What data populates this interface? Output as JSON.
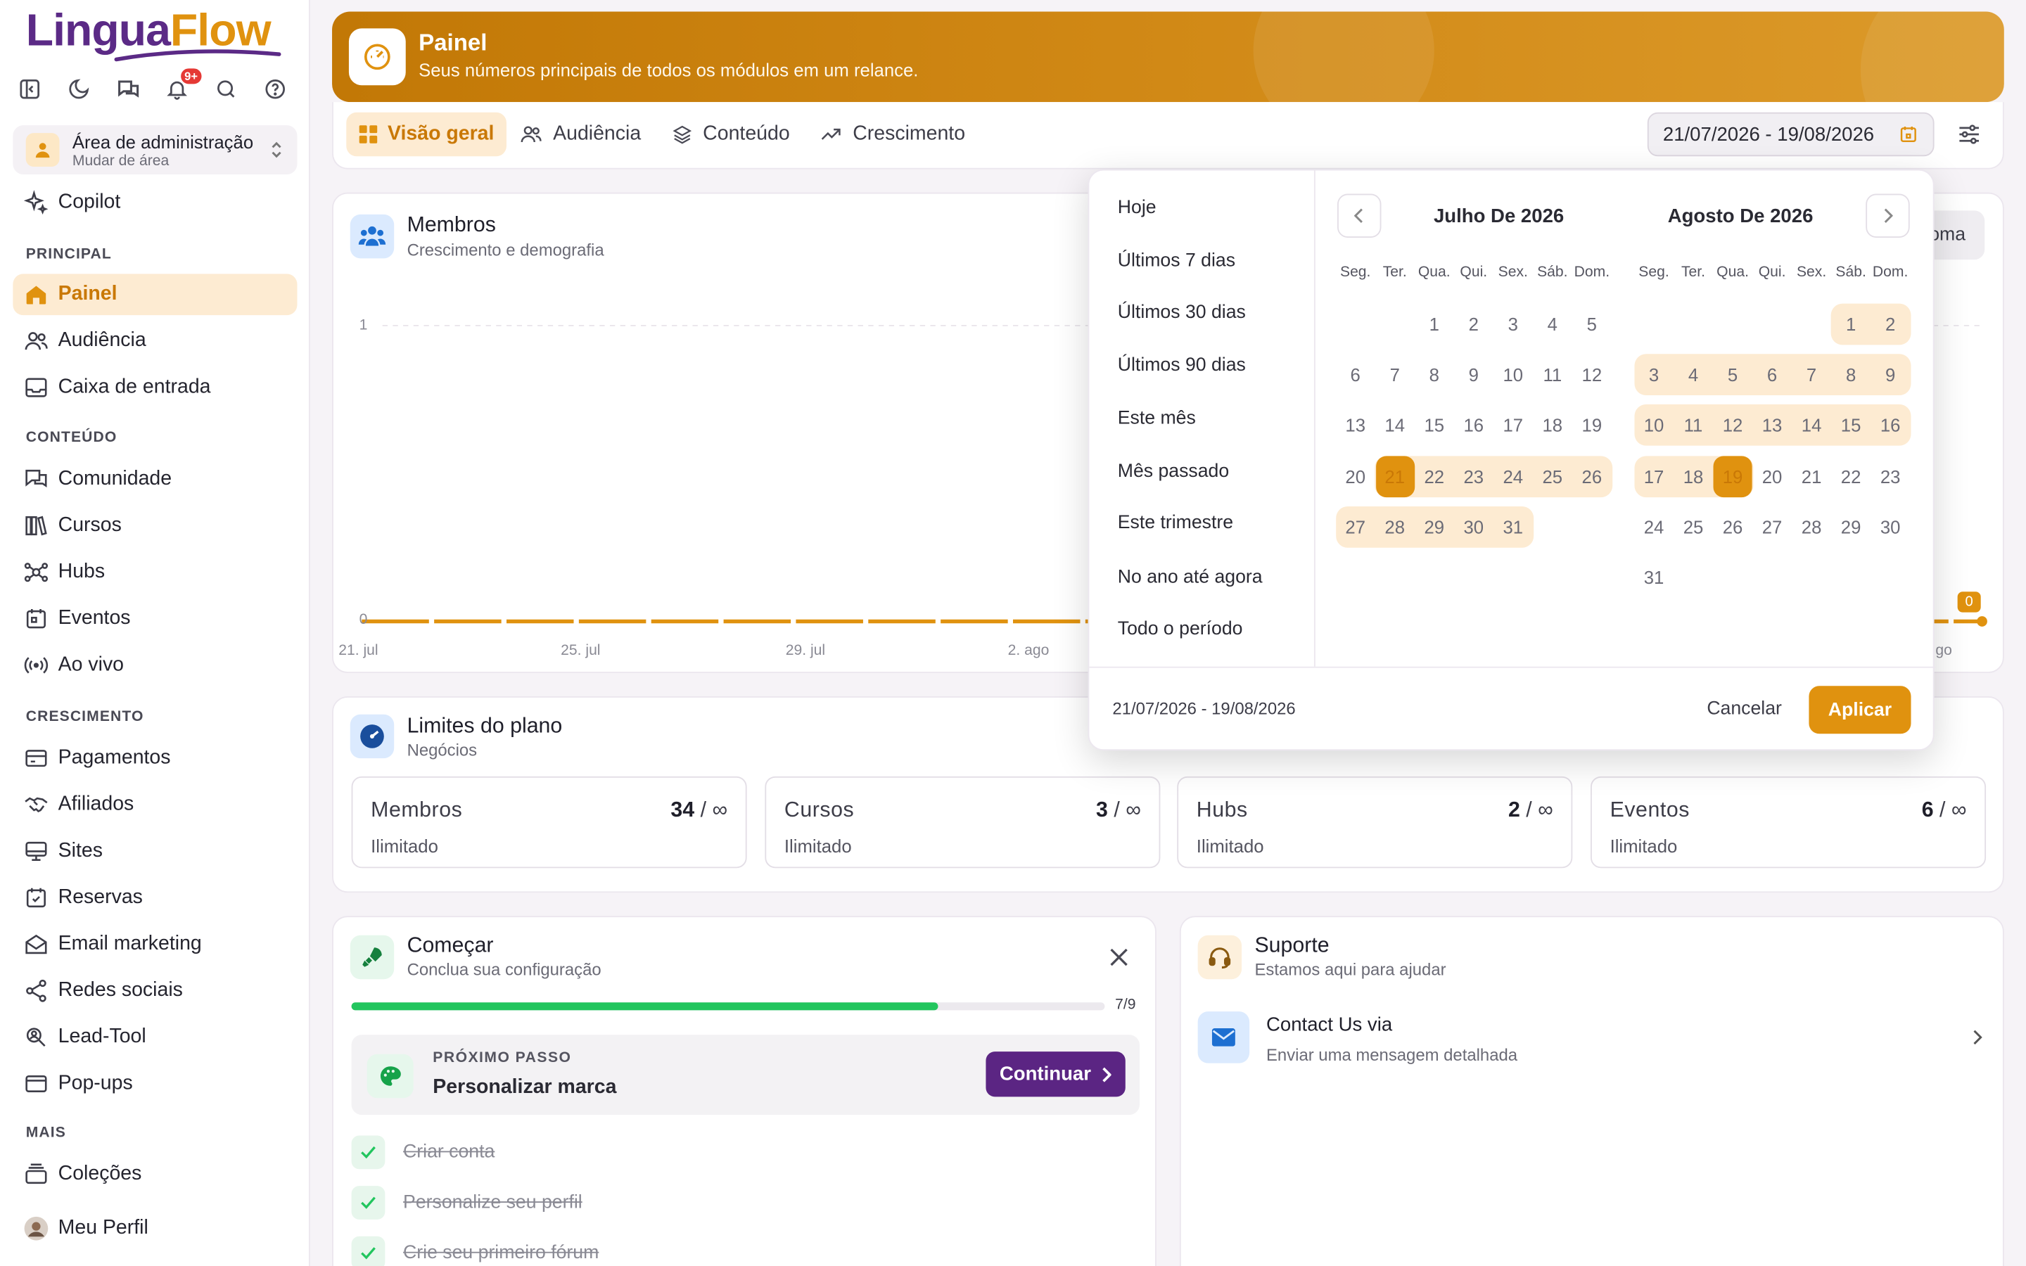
{
  "app": {
    "logo_part1": "Lingua",
    "logo_part2": "Flow"
  },
  "sidebar": {
    "notif_badge": "9+",
    "area_title": "Área de administração",
    "area_sub": "Mudar de área",
    "copilot": "Copilot",
    "sections": {
      "principal": "PRINCIPAL",
      "conteudo": "CONTEÚDO",
      "crescimento": "CRESCIMENTO",
      "mais": "MAIS"
    },
    "items": {
      "painel": "Painel",
      "audiencia": "Audiência",
      "caixa": "Caixa de entrada",
      "comunidade": "Comunidade",
      "cursos": "Cursos",
      "hubs": "Hubs",
      "eventos": "Eventos",
      "aovivo": "Ao vivo",
      "pagamentos": "Pagamentos",
      "afiliados": "Afiliados",
      "sites": "Sites",
      "reservas": "Reservas",
      "email": "Email marketing",
      "redes": "Redes sociais",
      "lead": "Lead-Tool",
      "popups": "Pop-ups",
      "colecoes": "Coleções",
      "perfil": "Meu Perfil"
    }
  },
  "header": {
    "title": "Painel",
    "subtitle": "Seus números principais de todos os módulos em um relance."
  },
  "tabs": {
    "visao": "Visão geral",
    "audiencia": "Audiência",
    "conteudo": "Conteúdo",
    "crescimento": "Crescimento"
  },
  "date_range": "21/07/2026 - 19/08/2026",
  "members_card": {
    "title": "Membros",
    "subtitle": "Crescimento e demografia",
    "hidden_button_text": "oma",
    "badge": "0",
    "chart_data": {
      "type": "line",
      "x": [
        "21. jul",
        "25. jul",
        "29. jul",
        "2. ago"
      ],
      "x_last_partial": "go",
      "y_ticks": [
        "0",
        "1"
      ],
      "ylim": [
        0,
        1
      ],
      "series": [
        {
          "values": [
            0,
            0,
            0,
            0,
            0
          ]
        }
      ]
    }
  },
  "limits_card": {
    "title": "Limites do plano",
    "subtitle": "Negócios",
    "infinity": "∞",
    "items": [
      {
        "name": "Membros",
        "value": "34",
        "sep": "/",
        "label": "Ilimitado"
      },
      {
        "name": "Cursos",
        "value": "3",
        "sep": "/",
        "label": "Ilimitado"
      },
      {
        "name": "Hubs",
        "value": "2",
        "sep": "/",
        "label": "Ilimitado"
      },
      {
        "name": "Eventos",
        "value": "6",
        "sep": "/",
        "label": "Ilimitado"
      }
    ]
  },
  "start_card": {
    "title": "Começar",
    "subtitle": "Conclua sua configuração",
    "progress_text": "7/9",
    "progress_fraction": 0.778,
    "next_label": "PRÓXIMO PASSO",
    "next_title": "Personalizar marca",
    "continue_label": "Continuar",
    "done": [
      "Criar conta",
      "Personalize seu perfil",
      "Crie seu primeiro fórum"
    ]
  },
  "support_card": {
    "title": "Suporte",
    "subtitle": "Estamos aqui para ajudar",
    "contact_title": "Contact Us via",
    "contact_sub": "Enviar uma mensagem detalhada"
  },
  "datepicker": {
    "presets": [
      "Hoje",
      "Últimos 7 dias",
      "Últimos 30 dias",
      "Últimos 90 dias",
      "Este mês",
      "Mês passado",
      "Este trimestre",
      "No ano até agora",
      "Todo o período"
    ],
    "weekdays": [
      "Seg.",
      "Ter.",
      "Qua.",
      "Qui.",
      "Sex.",
      "Sáb.",
      "Dom."
    ],
    "months": [
      {
        "title": "Julho De 2026",
        "first_weekday": 2,
        "days": 31,
        "range_start": 21,
        "range_end": 31,
        "selected": 21
      },
      {
        "title": "Agosto De 2026",
        "first_weekday": 5,
        "days": 31,
        "range_start": 1,
        "range_end": 19,
        "selected": 19
      }
    ],
    "footer_range": "21/07/2026 - 19/08/2026",
    "cancel": "Cancelar",
    "apply": "Aplicar",
    "accent": "#e0920f",
    "range_bg": "#fdebd2"
  }
}
